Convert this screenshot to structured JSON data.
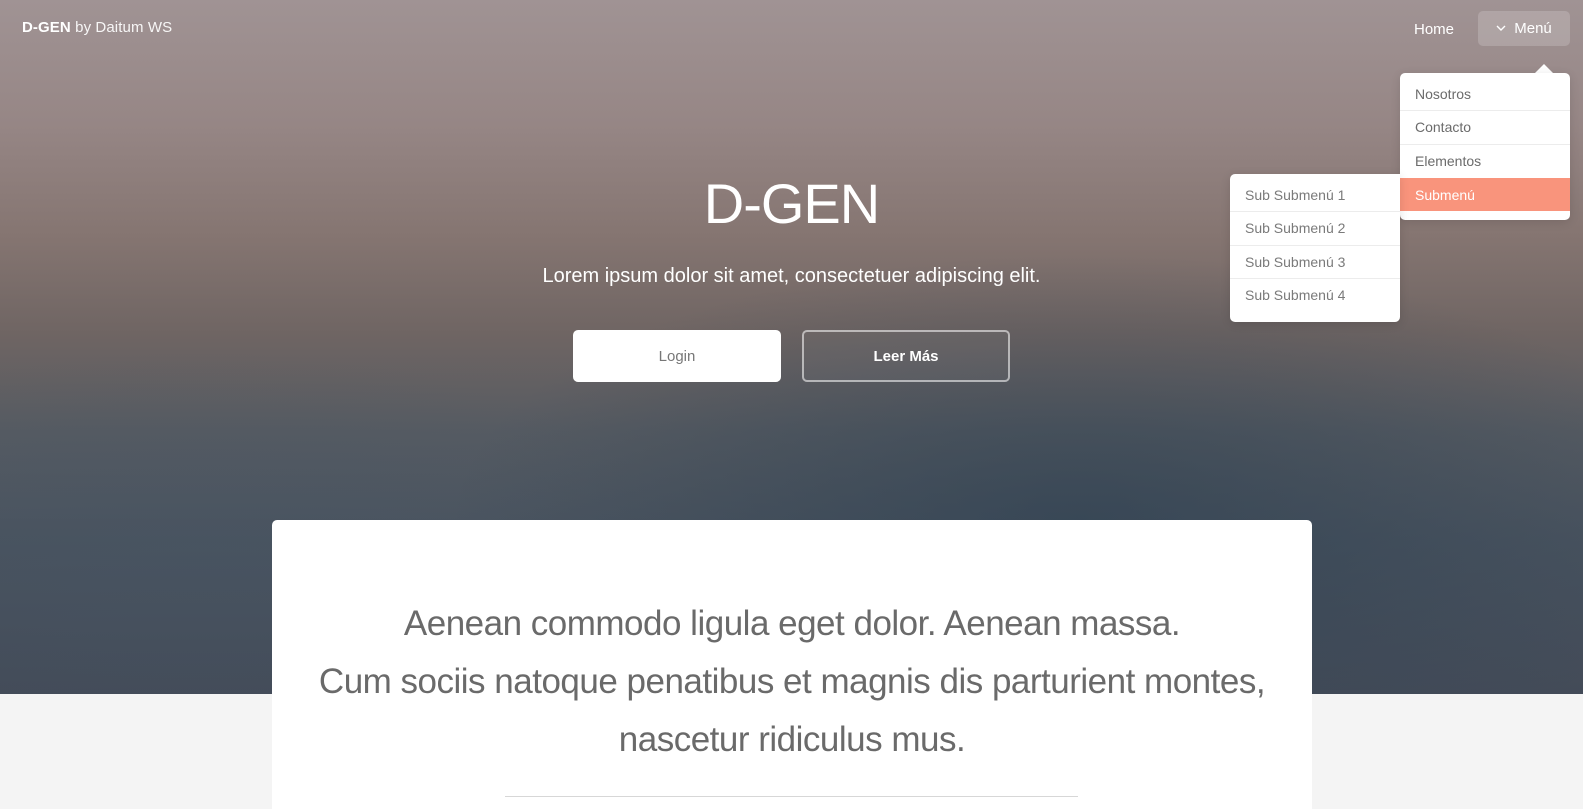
{
  "header": {
    "brand_strong": "D-GEN",
    "brand_light": "by Daitum WS",
    "nav": {
      "home_label": "Home",
      "menu_label": "Menú",
      "menu_icon": "chevron-down-icon"
    }
  },
  "dropdown": {
    "items": [
      {
        "label": "Nosotros"
      },
      {
        "label": "Contacto"
      },
      {
        "label": "Elementos"
      },
      {
        "label": "Submenú",
        "active": true
      }
    ],
    "submenu": {
      "items": [
        {
          "label": "Sub Submenú 1"
        },
        {
          "label": "Sub Submenú 2"
        },
        {
          "label": "Sub Submenú 3"
        },
        {
          "label": "Sub Submenú 4"
        }
      ]
    }
  },
  "hero": {
    "title": "D-GEN",
    "subtitle": "Lorem ipsum dolor sit amet, consectetuer adipiscing elit.",
    "buttons": {
      "login": "Login",
      "more": "Leer Más"
    }
  },
  "card": {
    "lines": [
      "Aenean commodo ligula eget dolor. Aenean massa.",
      "Cum sociis natoque penatibus et magnis dis parturient montes,",
      "nascetur ridiculus mus."
    ]
  },
  "colors": {
    "accent": "#f9947c",
    "hero_top": "#a09394",
    "hero_bottom": "#434b58",
    "page_bg": "#f4f4f4"
  }
}
